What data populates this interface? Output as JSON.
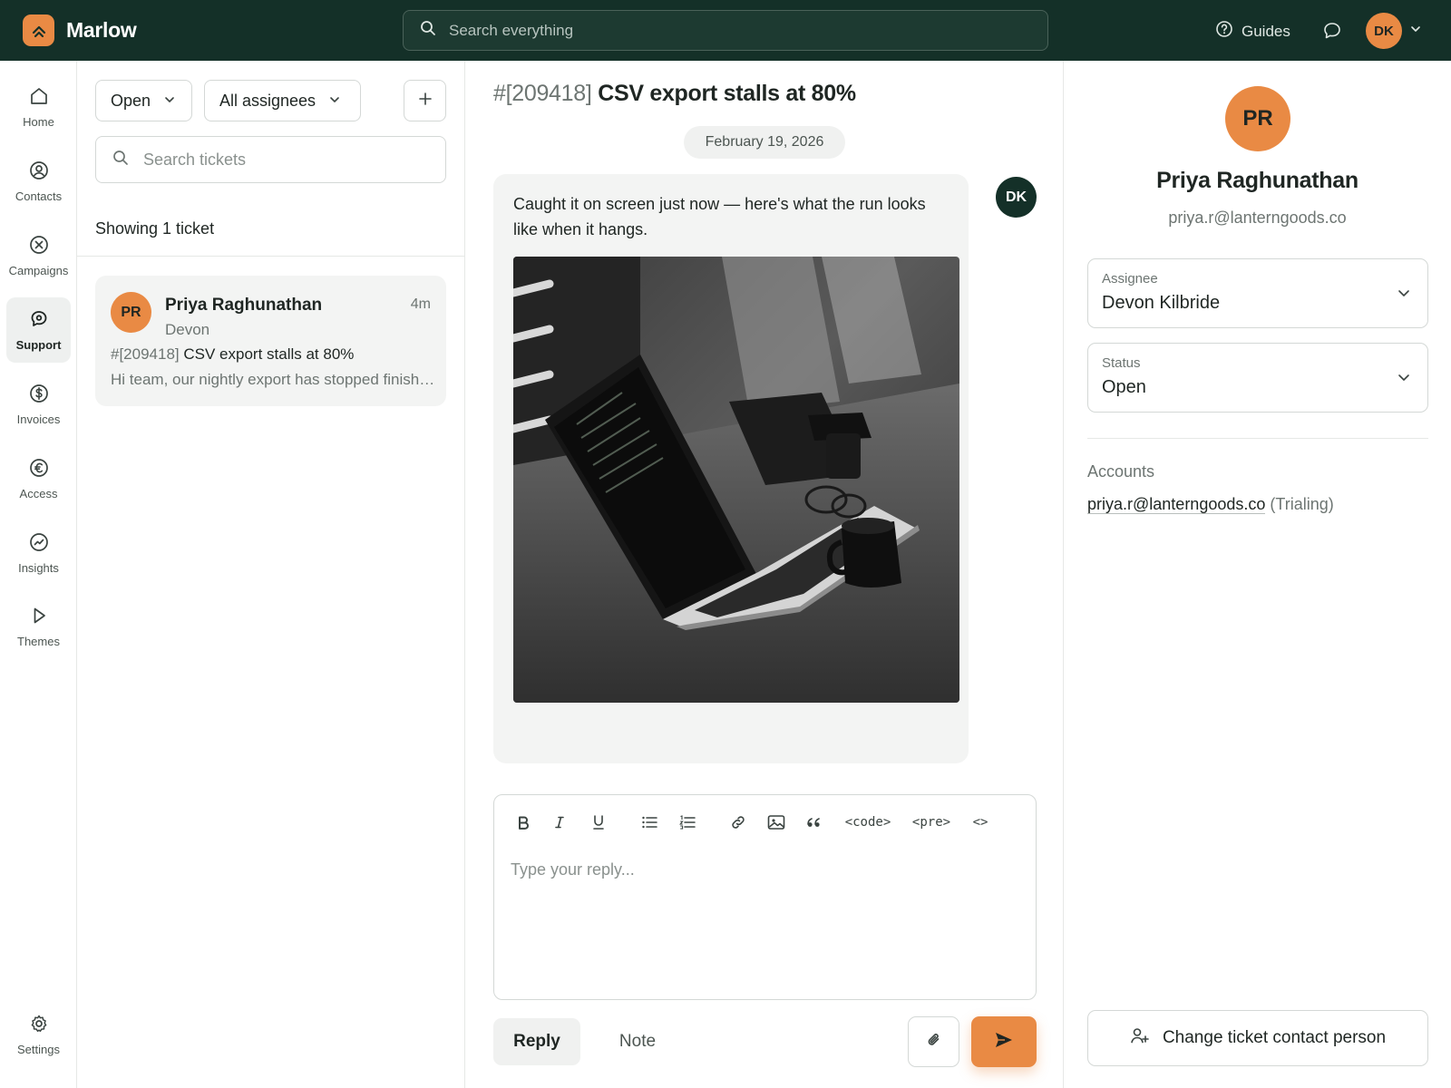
{
  "app": {
    "name": "Marlow"
  },
  "topbar": {
    "search_placeholder": "Search everything",
    "guides_label": "Guides",
    "user_initials": "DK"
  },
  "nav": {
    "items": [
      {
        "label": "Home",
        "icon": "home-icon"
      },
      {
        "label": "Contacts",
        "icon": "person-circle-icon"
      },
      {
        "label": "Campaigns",
        "icon": "x-circle-icon"
      },
      {
        "label": "Support",
        "icon": "chat-bubble-icon",
        "active": true
      },
      {
        "label": "Invoices",
        "icon": "dollar-circle-icon"
      },
      {
        "label": "Access",
        "icon": "euro-circle-icon"
      },
      {
        "label": "Insights",
        "icon": "trend-circle-icon"
      },
      {
        "label": "Themes",
        "icon": "play-icon"
      }
    ],
    "settings_label": "Settings"
  },
  "list": {
    "status_filter": "Open",
    "assignee_filter": "All assignees",
    "search_placeholder": "Search tickets",
    "showing_text": "Showing 1 ticket",
    "tickets": [
      {
        "initials": "PR",
        "name": "Priya Raghunathan",
        "time": "4m",
        "assignee": "Devon",
        "number": "#[209418]",
        "subject": "CSV export stalls at 80%",
        "preview": "Hi team, our nightly export has stopped finishing"
      }
    ]
  },
  "thread": {
    "ticket_number": "#[209418]",
    "ticket_subject": "CSV export stalls at 80%",
    "date": "February 19, 2026",
    "message": {
      "text": "Caught it on screen just now — here's what the run looks like when it hangs.",
      "author_initials": "DK"
    },
    "composer": {
      "placeholder": "Type your reply...",
      "toolbar": {
        "code": "<code>",
        "pre": "<pre>",
        "source": "<>"
      }
    },
    "tabs": {
      "reply": "Reply",
      "note": "Note"
    }
  },
  "contact": {
    "initials": "PR",
    "name": "Priya Raghunathan",
    "email": "priya.r@lanterngoods.co",
    "assignee_label": "Assignee",
    "assignee_value": "Devon Kilbride",
    "status_label": "Status",
    "status_value": "Open",
    "accounts_label": "Accounts",
    "account_email": "priya.r@lanterngoods.co",
    "account_status": "(Trialing)",
    "change_button": "Change ticket contact person"
  },
  "colors": {
    "topbar_bg": "#143028",
    "accent": "#e98a44"
  }
}
